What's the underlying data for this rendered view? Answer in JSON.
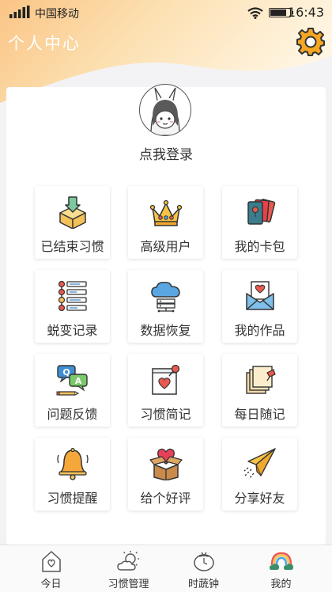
{
  "status": {
    "carrier": "中国移动",
    "time": "16:43",
    "battery_level": 0.85
  },
  "header": {
    "title": "个人中心",
    "settings_icon": "gear-icon"
  },
  "profile": {
    "login_label": "点我登录",
    "avatar_icon": "cartoon-girl-avatar"
  },
  "grid": [
    {
      "key": "ended-habits",
      "label": "已结束习惯",
      "icon": "box-download-icon"
    },
    {
      "key": "premium-user",
      "label": "高级用户",
      "icon": "crown-icon"
    },
    {
      "key": "my-cards",
      "label": "我的卡包",
      "icon": "card-pack-icon"
    },
    {
      "key": "transform-log",
      "label": "蜕变记录",
      "icon": "timeline-icon"
    },
    {
      "key": "data-restore",
      "label": "数据恢复",
      "icon": "cloud-server-icon"
    },
    {
      "key": "my-works",
      "label": "我的作品",
      "icon": "heart-envelope-icon"
    },
    {
      "key": "feedback",
      "label": "问题反馈",
      "icon": "qa-chat-icon"
    },
    {
      "key": "habit-notes",
      "label": "习惯简记",
      "icon": "pinned-note-icon"
    },
    {
      "key": "daily-notes",
      "label": "每日随记",
      "icon": "sticky-notes-icon"
    },
    {
      "key": "habit-reminder",
      "label": "习惯提醒",
      "icon": "bell-icon"
    },
    {
      "key": "give-rating",
      "label": "给个好评",
      "icon": "heart-box-icon"
    },
    {
      "key": "share-friends",
      "label": "分享好友",
      "icon": "paper-plane-icon"
    }
  ],
  "tabs": [
    {
      "key": "today",
      "label": "今日",
      "icon": "house-heart-icon"
    },
    {
      "key": "habits",
      "label": "习惯管理",
      "icon": "sun-cloud-icon"
    },
    {
      "key": "timer",
      "label": "时蔬钟",
      "icon": "tomato-icon"
    },
    {
      "key": "mine",
      "label": "我的",
      "icon": "rainbow-cloud-icon",
      "active": true
    }
  ],
  "colors": {
    "header_gradient_start": "#f9b86b",
    "header_gradient_end": "#fde7bd",
    "accent": "#f2b134",
    "text": "#333333"
  }
}
